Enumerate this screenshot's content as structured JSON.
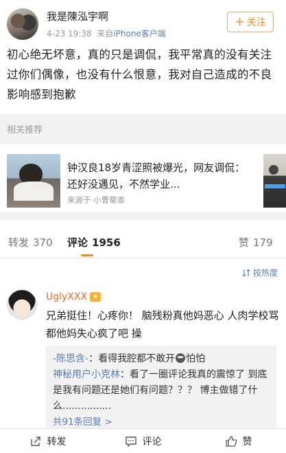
{
  "post": {
    "user_name": "我是陳泓宇啊",
    "date": "4-23 19:38",
    "source_prefix": "来自",
    "source_name": "iPhone客户端",
    "follow_label": "关注",
    "text": "初心绝无坏意，真的只是调侃，我平常真的没有关注过你们偶像，也没有什么恨意，我对自己造成的不良影响感到抱歉"
  },
  "recommend": {
    "header": "相关推荐",
    "title": "钟汉良18岁青涩照被爆光，网友调侃：还好没遇见，不然学业...",
    "source": "来源于 小曹蜀黍"
  },
  "tabs": [
    {
      "label": "转发",
      "count": "370"
    },
    {
      "label": "评论",
      "count": "1956"
    },
    {
      "label": "赞",
      "count": "179"
    }
  ],
  "comments": {
    "sort_label": "按热度",
    "user": "UglyXXX",
    "text": "兄弟挺住！心疼你！ 脑残粉真他妈恶心 人肉学校骂 都他妈失心疯了吧 操",
    "replies": [
      {
        "user": "-陈思含-",
        "text_before": "：看得我腔都不敢开",
        "text_after": "怕怕"
      },
      {
        "user": "神秘用户小克林",
        "text": "：看了一圈评论我真的震惊了 到底是我有问题还是她们有问题？？？ 博主做错了什么................"
      }
    ],
    "reply_count": "共91条回复 >"
  },
  "bottom_bar": {
    "repost": "转发",
    "comment": "评论",
    "like": "赞"
  },
  "colors": {
    "accent": "#f08a28",
    "link": "#5a7fb5"
  }
}
